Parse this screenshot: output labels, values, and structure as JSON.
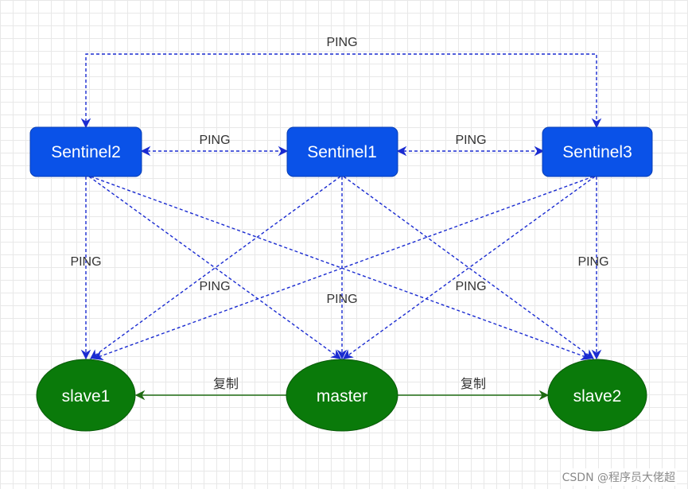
{
  "nodes": {
    "sentinel2": "Sentinel2",
    "sentinel1": "Sentinel1",
    "sentinel3": "Sentinel3",
    "slave1": "slave1",
    "master": "master",
    "slave2": "slave2"
  },
  "edge_labels": {
    "ping_top": "PING",
    "ping_s2_s1": "PING",
    "ping_s1_s3": "PING",
    "ping_s2_slave1": "PING",
    "ping_cross_left": "PING",
    "ping_s1_master": "PING",
    "ping_cross_right": "PING",
    "ping_s3_slave2": "PING",
    "replicate_left": "复制",
    "replicate_right": "复制"
  },
  "colors": {
    "sentinel_fill": "#0a52e8",
    "node_fill": "#0a7a0a",
    "ping_edge": "#1a2bd1",
    "replicate_edge": "#1f6b12"
  },
  "watermark": "CSDN @程序员大佬超"
}
